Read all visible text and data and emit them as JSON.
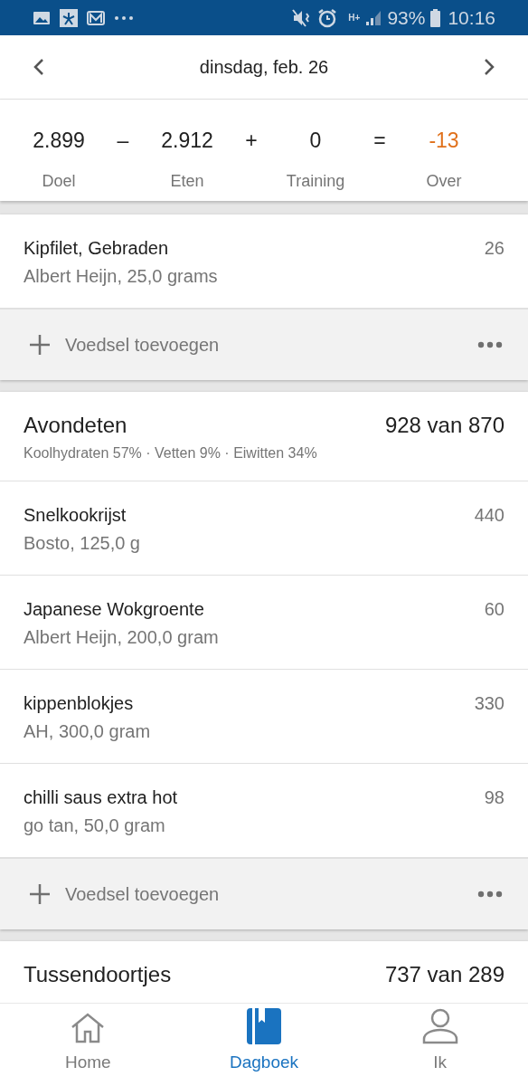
{
  "status_bar": {
    "network": "H+",
    "battery": "93%",
    "time": "10:16"
  },
  "header": {
    "date": "dinsdag, feb. 26"
  },
  "summary": {
    "terms": [
      {
        "value": "2.899",
        "label": "Doel",
        "negative": false
      },
      {
        "value": "2.912",
        "label": "Eten",
        "negative": false
      },
      {
        "value": "0",
        "label": "Training",
        "negative": false
      },
      {
        "value": "-13",
        "label": "Over",
        "negative": true
      }
    ],
    "operators": [
      "–",
      "+",
      "="
    ]
  },
  "sections": [
    {
      "items": [
        {
          "name": "Kipfilet, Gebraden",
          "detail": "Albert Heijn, 25,0 grams",
          "calories": "26"
        }
      ],
      "add_button": "Voedsel toevoegen"
    },
    {
      "title": "Avondeten",
      "total": "928 van 870",
      "macros": "Koolhydraten 57% · Vetten 9% · Eiwitten 34%",
      "items": [
        {
          "name": "Snelkookrijst",
          "detail": "Bosto, 125,0 g",
          "calories": "440"
        },
        {
          "name": "Japanese Wokgroente",
          "detail": "Albert Heijn, 200,0 gram",
          "calories": "60"
        },
        {
          "name": "kippenblokjes",
          "detail": "AH, 300,0 gram",
          "calories": "330"
        },
        {
          "name": "chilli saus extra hot",
          "detail": "go tan, 50,0 gram",
          "calories": "98"
        }
      ],
      "add_button": "Voedsel toevoegen"
    },
    {
      "title": "Tussendoortjes",
      "total": "737 van 289"
    }
  ],
  "nav": [
    {
      "label": "Home",
      "selected": false
    },
    {
      "label": "Dagboek",
      "selected": true
    },
    {
      "label": "Ik",
      "selected": false
    }
  ]
}
